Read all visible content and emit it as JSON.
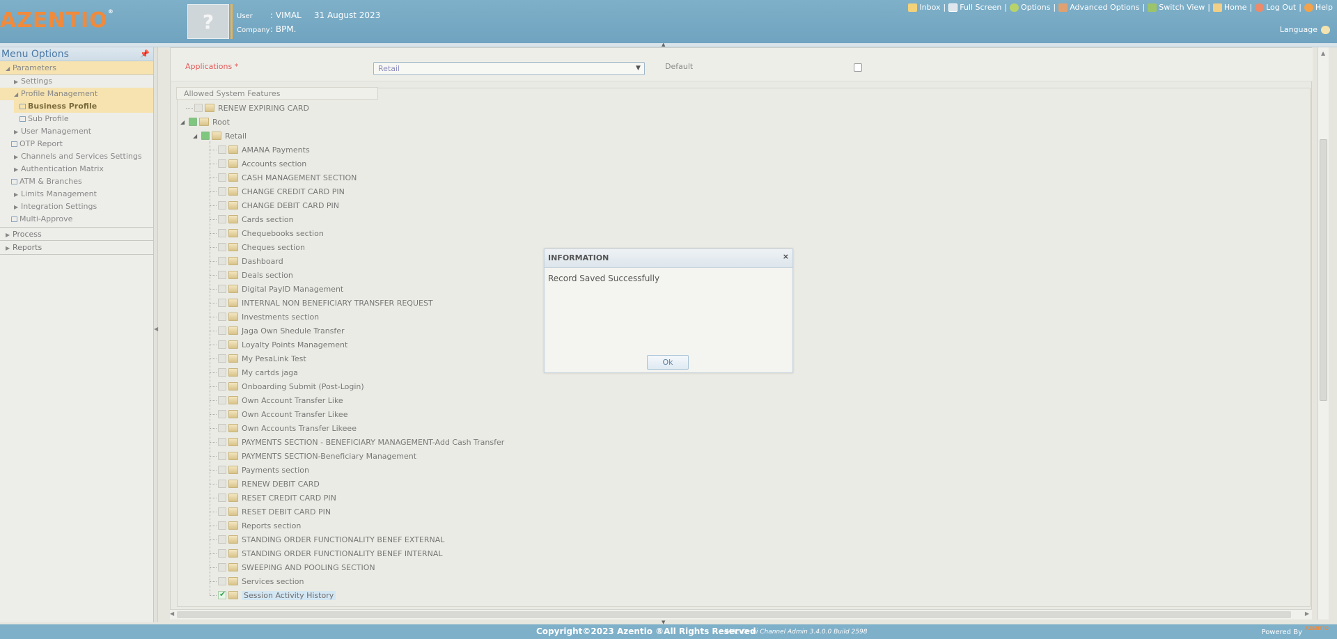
{
  "header": {
    "logo": "AZENTIO",
    "logo_mark": "®",
    "user_label": "User",
    "user_value": ": VIMAL",
    "date": "31 August 2023",
    "company_label": "Company",
    "company_value": ": BPM.",
    "nav": [
      {
        "label": "Inbox",
        "icon": "inbox-icon"
      },
      {
        "label": "Full Screen",
        "icon": "fullscreen-icon"
      },
      {
        "label": "Options",
        "icon": "options-icon"
      },
      {
        "label": "Advanced Options",
        "icon": "advanced-options-icon"
      },
      {
        "label": "Switch View",
        "icon": "switch-view-icon"
      },
      {
        "label": "Home",
        "icon": "home-icon"
      },
      {
        "label": "Log Out",
        "icon": "logout-icon"
      },
      {
        "label": "Help",
        "icon": "help-icon"
      }
    ],
    "language": "Language"
  },
  "sidebar": {
    "title": "Menu Options",
    "parameters": "Parameters",
    "items": {
      "settings": "Settings",
      "profile_management": "Profile Management",
      "business_profile": "Business Profile",
      "sub_profile": "Sub Profile",
      "user_management": "User Management",
      "otp_report": "OTP Report",
      "channels": "Channels and Services Settings",
      "auth_matrix": "Authentication Matrix",
      "atm": "ATM & Branches",
      "limits": "Limits Management",
      "integration": "Integration Settings",
      "multi_approve": "Multi-Approve"
    },
    "process": "Process",
    "reports": "Reports"
  },
  "form": {
    "applications_label": "Applications *",
    "applications_value": "Retail",
    "default_label": "Default",
    "default_checked": false
  },
  "features": {
    "legend": "Allowed System Features",
    "tree": {
      "renew_expiring": "RENEW EXPIRING CARD",
      "root": "Root",
      "retail": "Retail",
      "children": [
        "AMANA Payments",
        "Accounts section",
        "CASH MANAGEMENT SECTION",
        "CHANGE CREDIT CARD PIN",
        "CHANGE DEBIT CARD PIN",
        "Cards section",
        "Chequebooks section",
        "Cheques section",
        "Dashboard",
        "Deals section",
        "Digital PayID Management",
        "INTERNAL NON BENEFICIARY TRANSFER REQUEST",
        "Investments section",
        "Jaga Own Shedule Transfer",
        "Loyalty Points Management",
        "My PesaLink Test",
        "My cartds jaga",
        "Onboarding Submit (Post-Login)",
        "Own Account Transfer Like",
        "Own Account Transfer Likee",
        "Own Accounts Transfer Likeee",
        "PAYMENTS SECTION - BENEFICIARY MANAGEMENT-Add Cash Transfer",
        "PAYMENTS SECTION-Beneficiary Management",
        "Payments section",
        "RENEW DEBIT CARD",
        "RESET CREDIT CARD PIN",
        "RESET DEBIT CARD PIN",
        "Reports section",
        "STANDING ORDER FUNCTIONALITY BENEF EXTERNAL",
        "STANDING ORDER FUNCTIONALITY BENEF INTERNAL",
        "SWEEPING AND POOLING SECTION",
        "Services section",
        "Session Activity History"
      ]
    }
  },
  "dialog": {
    "title": "INFORMATION",
    "close": "×",
    "message": "Record Saved Successfully",
    "ok": "Ok"
  },
  "footer": {
    "copyright": "Copyright©2023 Azentio ®All Rights Reserved",
    "build": "iMAL Omni Channel Admin 3.4.0.0 Build 2598",
    "powered": "Powered By",
    "powered_logo": "AZENTIO"
  },
  "colors": {
    "header": "#7fb0c9",
    "logo": "#f08a3c",
    "selection": "#f6e3b0",
    "required": "#e35b5b"
  }
}
